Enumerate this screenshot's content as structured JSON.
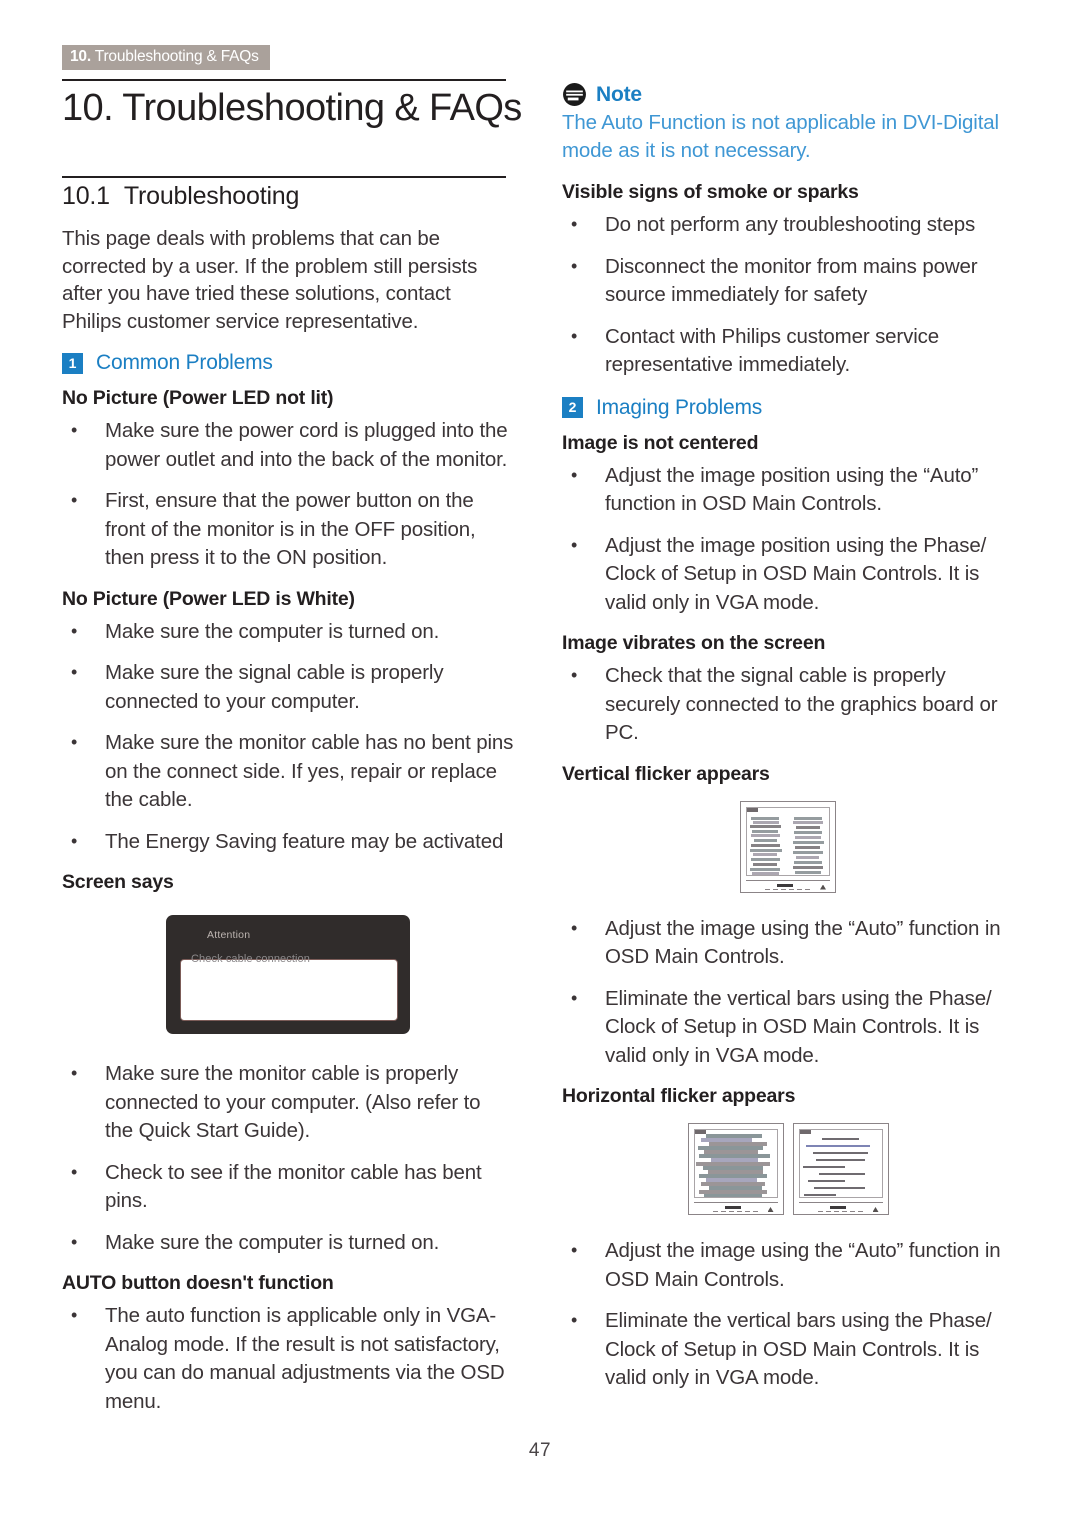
{
  "header": {
    "tab_number": "10.",
    "tab_label": "Troubleshooting & FAQs"
  },
  "chapter": {
    "title": "10. Troubleshooting & FAQs",
    "section_number": "10.1",
    "section_title": "Troubleshooting"
  },
  "left_column": {
    "intro": "This page deals with problems that can be corrected by a user. If the problem still persists after you have tried these solutions, contact Philips customer service representative.",
    "group1": {
      "badge": "1",
      "label": "Common Problems"
    },
    "sub1": "No Picture (Power LED not lit)",
    "bullets1": [
      "Make sure the power cord is plugged into the power outlet and into the back of the monitor.",
      "First, ensure that the power button on the front of the monitor is in the OFF position, then press it to the ON position."
    ],
    "sub2": "No Picture (Power LED is White)",
    "bullets2": [
      "Make sure the computer is turned on.",
      "Make sure the signal cable is properly connected to your computer.",
      "Make sure the monitor cable has no bent pins on the connect side. If yes, repair or replace the cable.",
      "The Energy Saving feature may be activated"
    ],
    "sub3": "Screen says",
    "osd_figure": {
      "title": "Attention",
      "message": "Check cable connection"
    },
    "bullets3": [
      "Make sure the monitor cable is properly connected to your computer. (Also refer to the Quick Start Guide).",
      "Check to see if the monitor cable has bent pins.",
      "Make sure the computer is turned on."
    ],
    "sub4": "AUTO button doesn't function",
    "bullets4": [
      "The auto function is applicable only in VGA-Analog mode. If the result is not satisfactory, you can do manual adjustments via the OSD menu."
    ]
  },
  "right_column": {
    "note": {
      "icon": "note-icon",
      "title": "Note",
      "body": "The Auto Function is not applicable in DVI-Digital mode as it is not necessary."
    },
    "sub1": "Visible signs of smoke or sparks",
    "bullets1": [
      "Do not perform any troubleshooting steps",
      "Disconnect the monitor from mains power source immediately for safety",
      "Contact with Philips customer service representative immediately."
    ],
    "group2": {
      "badge": "2",
      "label": "Imaging Problems"
    },
    "sub2": "Image is not centered",
    "bullets2": [
      "Adjust the image position using the “Auto” function in OSD Main Controls.",
      "Adjust the image position using the Phase/ Clock of Setup in OSD Main Controls. It is valid only in VGA mode."
    ],
    "sub3": "Image vibrates on the screen",
    "bullets3": [
      "Check that the signal cable is properly securely connected to the graphics board or PC."
    ],
    "sub4": "Vertical flicker appears",
    "bullets4": [
      "Adjust the image using the “Auto” function in OSD Main Controls.",
      "Eliminate the vertical bars using the Phase/ Clock of Setup in OSD Main Controls. It is valid only in VGA mode."
    ],
    "sub5": "Horizontal flicker appears",
    "bullets5": [
      "Adjust the image using the “Auto” function in OSD Main Controls.",
      "Eliminate the vertical bars using the Phase/ Clock of Setup in OSD Main Controls. It is valid only in VGA mode."
    ]
  },
  "footer": {
    "page_number": "47"
  },
  "colors": {
    "accent_blue": "#1b7fc3",
    "note_body_blue": "#3f97d4",
    "header_tab_bg": "#aaa19b",
    "body_text": "#3b3537",
    "heading_text": "#231f20"
  }
}
